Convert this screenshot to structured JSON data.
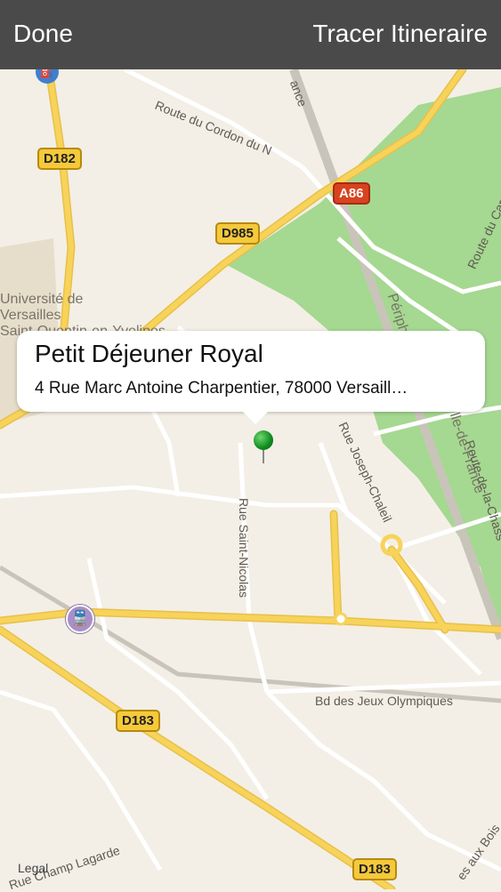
{
  "topbar": {
    "done_label": "Done",
    "route_label": "Tracer Itineraire"
  },
  "callout": {
    "title": "Petit Déjeuner Royal",
    "address": "4 Rue Marc Antoine Charpentier, 78000 Versaill…"
  },
  "map": {
    "shields": {
      "d182": "D182",
      "d985": "D985",
      "a86": "A86",
      "d183_a": "D183",
      "d183_b": "D183"
    },
    "labels": {
      "route_cordon": "Route du Cordon du N",
      "universite_1": "Université de",
      "universite_2": "Versailles",
      "universite_3": "Saint-Quentin-en-Yvelines",
      "rue_saint_nicolas": "Rue Saint-Nicolas",
      "rue_joseph": "Rue Joseph-Chaleil",
      "periph": "Périph",
      "ile_de_france": "lle-de-France",
      "route_du_carr": "Route du Carr",
      "route_de_la_chass": "Route-de-la-Chass",
      "bd_jeux": "Bd des Jeux Olympiques",
      "rue_champ": "Rue Champ Lagarde",
      "rue_aux_bois": "es aux Bois",
      "legal": "Legal",
      "ance": "ance"
    },
    "colors": {
      "land": "#f3efe6",
      "park": "#a5d891",
      "yellow_road": "#f7d35a",
      "white_road": "#ffffff",
      "pin": "#1a9a2a"
    }
  }
}
